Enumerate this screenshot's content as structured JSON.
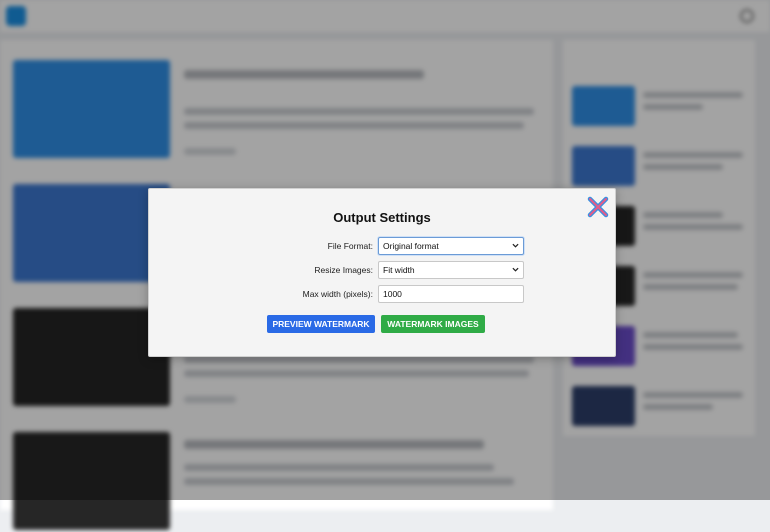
{
  "modal": {
    "title": "Output Settings",
    "fields": {
      "file_format": {
        "label": "File Format:",
        "value": "Original format"
      },
      "resize_images": {
        "label": "Resize Images:",
        "value": "Fit width"
      },
      "max_width": {
        "label": "Max width (pixels):",
        "value": "1000"
      }
    },
    "buttons": {
      "preview": "PREVIEW WATERMARK",
      "watermark": "WATERMARK IMAGES"
    }
  },
  "colors": {
    "preview_button": "#2a6ae6",
    "watermark_button": "#2fab46",
    "close_icon_primary": "#e35d8a",
    "close_icon_secondary": "#3a8fe0",
    "modal_background": "#f4f4f4",
    "brand_accent": "#1a8fe3"
  },
  "icons": {
    "close": "close-icon",
    "dropdown": "chevron-down-icon"
  }
}
